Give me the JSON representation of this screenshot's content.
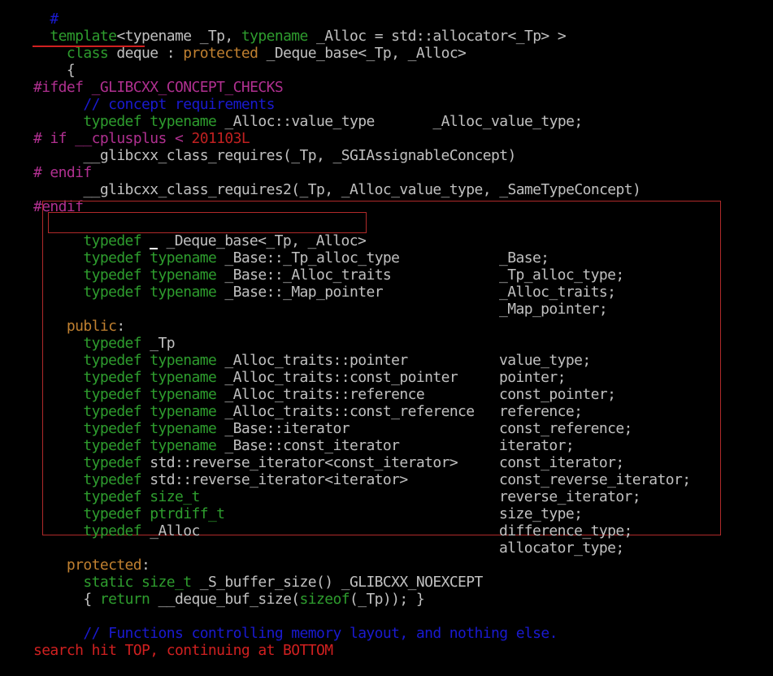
{
  "lines": {
    "l0": "  #",
    "l1_a": "  template",
    "l1_b": "<typename _Tp, ",
    "l1_c": "typename",
    "l1_d": " _Alloc = std::allocator<_Tp> >",
    "l2_a": "    class",
    "l2_b": " deque : ",
    "l2_c": "protected",
    "l2_d": " _Deque_base<_Tp, _Alloc>",
    "l3": "    {",
    "l4": "#ifdef _GLIBCXX_CONCEPT_CHECKS",
    "l5": "      // concept requirements",
    "l6_a": "      typedef",
    "l6_b": " typename",
    "l6_c": " _Alloc::value_type       _Alloc_value_type;",
    "l7_a": "# if __cplusplus < ",
    "l7_b": "201103L",
    "l8": "      __glibcxx_class_requires(_Tp, _SGIAssignableConcept)",
    "l9": "# endif",
    "l10": "      __glibcxx_class_requires2(_Tp, _Alloc_value_type, _SameTypeConcept)",
    "l11": "#endif"
  },
  "typedefs_base": [
    {
      "kw": "      typedef",
      "tn": "",
      "expr": " _Deque_base<_Tp, _Alloc>",
      "name": "_Base;"
    },
    {
      "kw": "      typedef",
      "tn": " typename",
      "expr": " _Base::_Tp_alloc_type",
      "name": "_Tp_alloc_type;"
    },
    {
      "kw": "      typedef",
      "tn": " typename",
      "expr": " _Base::_Alloc_traits",
      "name": "_Alloc_traits;"
    },
    {
      "kw": "      typedef",
      "tn": " typename",
      "expr": " _Base::_Map_pointer",
      "name": "_Map_pointer;"
    }
  ],
  "public_label": "    public",
  "public_colon": ":",
  "typedefs_public": [
    {
      "kw": "      typedef",
      "tn": "",
      "expr": " _Tp",
      "name": "value_type;"
    },
    {
      "kw": "      typedef",
      "tn": " typename",
      "expr": " _Alloc_traits::pointer",
      "name": "pointer;"
    },
    {
      "kw": "      typedef",
      "tn": " typename",
      "expr": " _Alloc_traits::const_pointer",
      "name": "const_pointer;"
    },
    {
      "kw": "      typedef",
      "tn": " typename",
      "expr": " _Alloc_traits::reference",
      "name": "reference;"
    },
    {
      "kw": "      typedef",
      "tn": " typename",
      "expr": " _Alloc_traits::const_reference",
      "name": "const_reference;"
    },
    {
      "kw": "      typedef",
      "tn": " typename",
      "expr": " _Base::iterator",
      "name": "iterator;"
    },
    {
      "kw": "      typedef",
      "tn": " typename",
      "expr": " _Base::const_iterator",
      "name": "const_iterator;"
    },
    {
      "kw": "      typedef",
      "tn": "",
      "expr": " std::reverse_iterator<const_iterator>",
      "name": "const_reverse_iterator;"
    },
    {
      "kw": "      typedef",
      "tn": "",
      "expr": " std::reverse_iterator<iterator>",
      "name": "reverse_iterator;"
    },
    {
      "kw": "      typedef",
      "tn": " size_t",
      "expr": "",
      "name": "size_type;"
    },
    {
      "kw": "      typedef",
      "tn": " ptrdiff_t",
      "expr": "",
      "name": "difference_type;"
    },
    {
      "kw": "      typedef",
      "tn": "",
      "expr": " _Alloc",
      "name": "allocator_type;"
    }
  ],
  "protected_label": "    protected",
  "protected_colon": ":",
  "l_static_a": "      static",
  "l_static_b": " size_t",
  "l_static_c": " _S_buffer_size() _GLIBCXX_NOEXCEPT",
  "l_ret_a": "      { ",
  "l_ret_b": "return",
  "l_ret_c": " __deque_buf_size(",
  "l_ret_d": "sizeof",
  "l_ret_e": "(_Tp)); }",
  "l_comment": "      // Functions controlling memory layout, and nothing else.",
  "status": "search hit TOP, continuing at BOTTOM",
  "colors": {
    "keyword": "#2e9d2e",
    "preprocessor": "#b03090",
    "comment": "#1a1ad0",
    "access": "#c08030",
    "highlight_box": "#b02a2a",
    "status": "#d02020"
  }
}
